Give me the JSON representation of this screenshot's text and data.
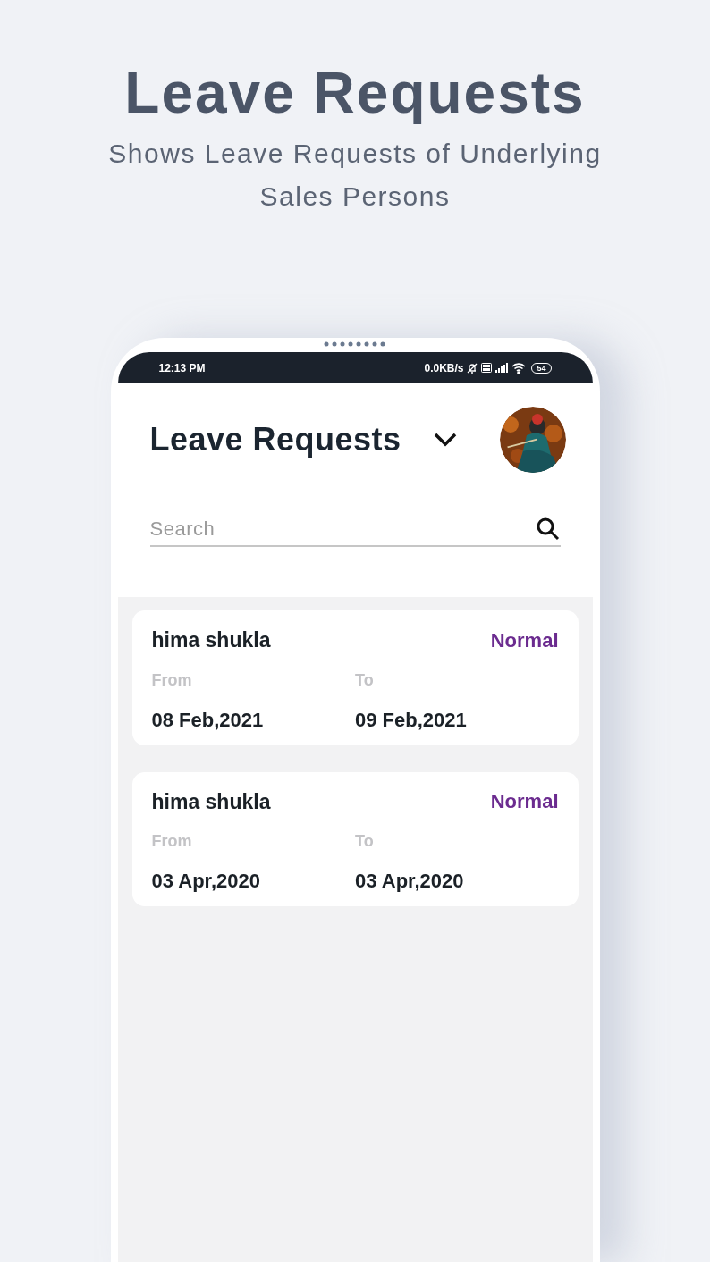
{
  "headline": {
    "title": "Leave Requests",
    "subtitle": "Shows Leave Requests of Underlying Sales Persons"
  },
  "status_bar": {
    "time": "12:13 PM",
    "speed": "0.0KB/s",
    "battery": "54"
  },
  "header": {
    "title": "Leave Requests"
  },
  "search": {
    "placeholder": "Search"
  },
  "requests": [
    {
      "name": "hima shukla",
      "type": "Normal",
      "color": "#6b2b8f",
      "from_label": "From",
      "from": "08 Feb,2021",
      "to_label": "To",
      "to": "09 Feb,2021"
    },
    {
      "name": "hima shukla",
      "type": "Normal",
      "color": "#6b2b8f",
      "from_label": "From",
      "from": "03 Apr,2020",
      "to_label": "To",
      "to": "03 Apr,2020"
    }
  ]
}
